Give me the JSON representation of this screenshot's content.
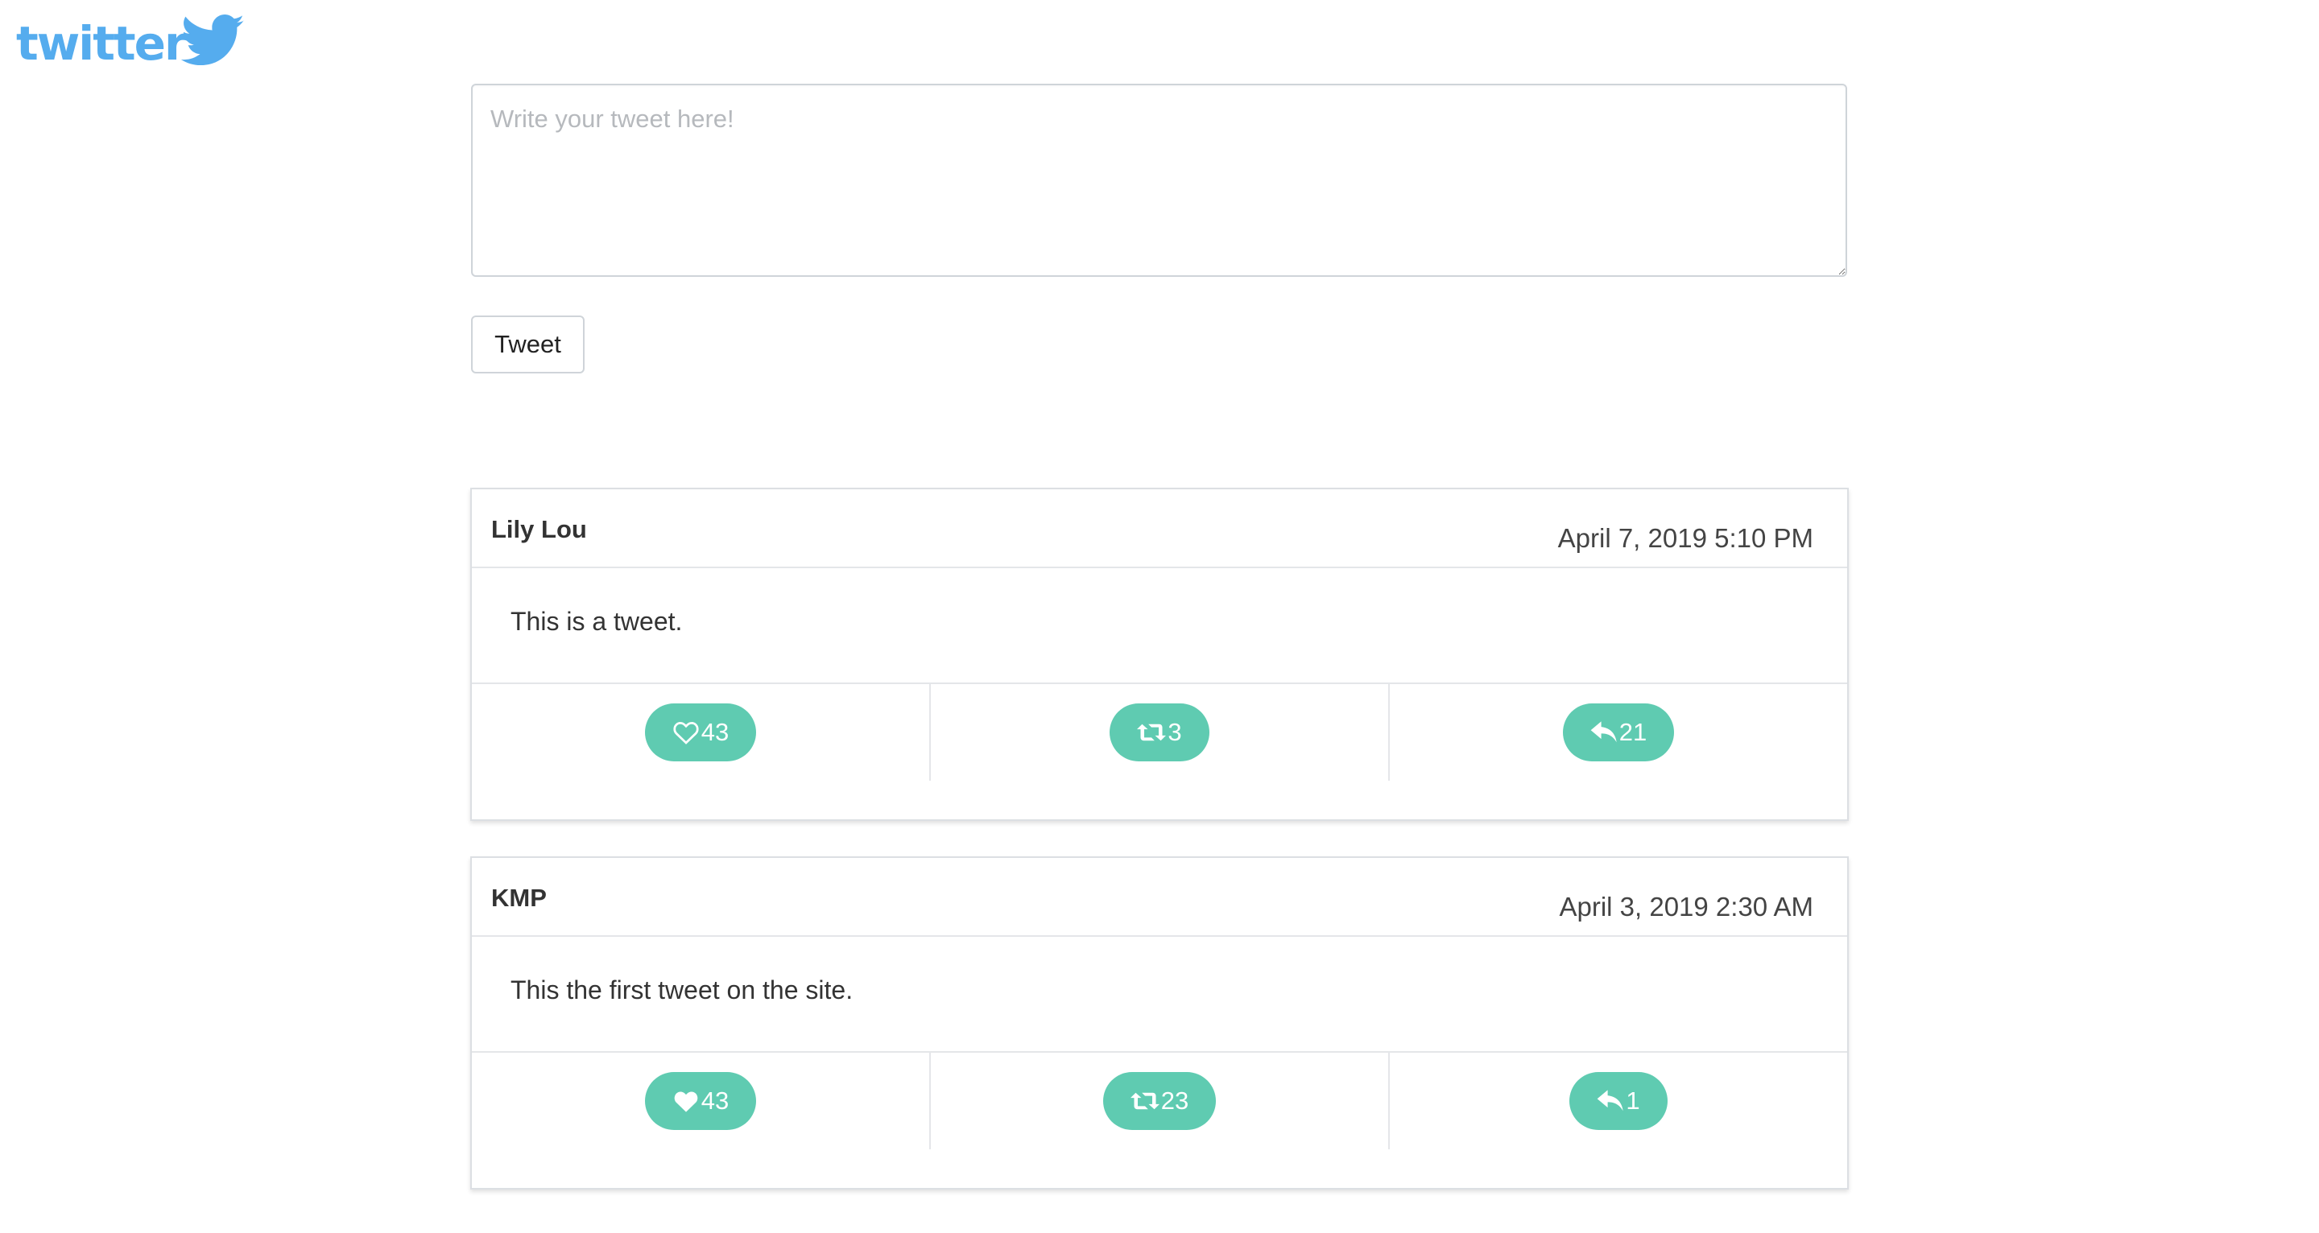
{
  "brand": {
    "logo_text": "twitter",
    "color": "#55acee"
  },
  "composer": {
    "placeholder": "Write your tweet here!"
  },
  "tweet_button": {
    "label": "Tweet"
  },
  "accent_color": "#5fcbb1",
  "tweets": [
    {
      "author": "Lily Lou",
      "date": "April 7, 2019 5:10 PM",
      "text": "This is a tweet.",
      "likes": "43",
      "like_icon": "heart-outline-icon",
      "retweets": "3",
      "replies": "21"
    },
    {
      "author": "KMP",
      "date": "April 3, 2019 2:30 AM",
      "text": "This the first tweet on the site.",
      "likes": "43",
      "like_icon": "heart-filled-icon",
      "retweets": "23",
      "replies": "1"
    }
  ]
}
